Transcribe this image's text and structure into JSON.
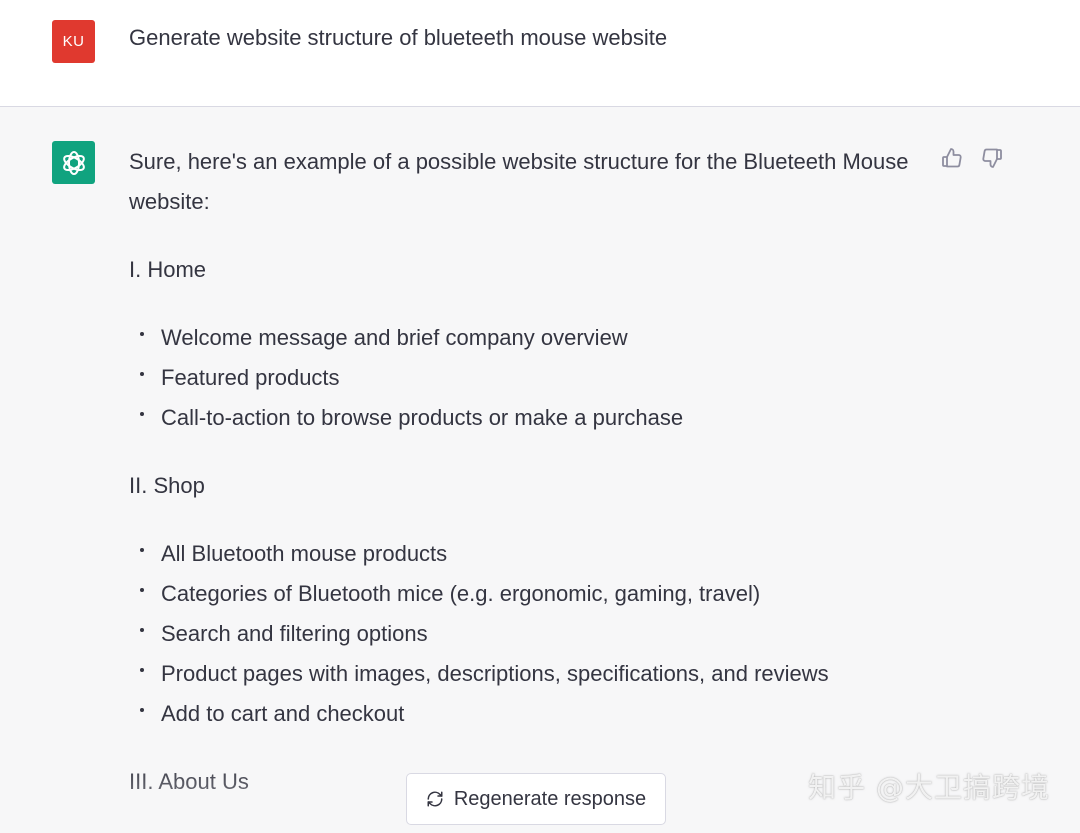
{
  "user_message": {
    "avatar_initials": "KU",
    "avatar_color": "#e0392f",
    "text": "Generate website structure of blueteeth mouse website"
  },
  "assistant_message": {
    "avatar_icon": "openai-logo-icon",
    "avatar_color": "#10a37f",
    "intro": "Sure, here's an example of a possible website structure for the Blueteeth Mouse website:",
    "sections": [
      {
        "heading": "I. Home",
        "items": [
          "Welcome message and brief company overview",
          "Featured products",
          "Call-to-action to browse products or make a purchase"
        ]
      },
      {
        "heading": "II. Shop",
        "items": [
          "All Bluetooth mouse products",
          "Categories of Bluetooth mice (e.g. ergonomic, gaming, travel)",
          "Search and filtering options",
          "Product pages with images, descriptions, specifications, and reviews",
          "Add to cart and checkout"
        ]
      },
      {
        "heading": "III. About Us",
        "items": []
      }
    ]
  },
  "feedback": {
    "thumbs_up_icon": "thumbs-up-icon",
    "thumbs_down_icon": "thumbs-down-icon"
  },
  "regenerate": {
    "icon": "refresh-icon",
    "label": "Regenerate response"
  },
  "watermark": {
    "text": "知乎 @大卫搞跨境"
  }
}
